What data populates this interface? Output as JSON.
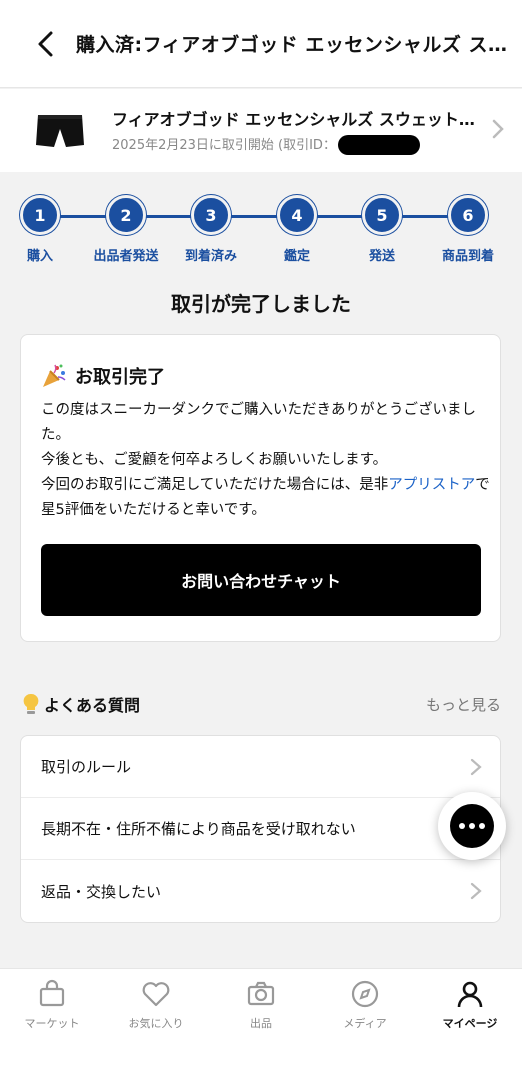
{
  "header": {
    "title": "購入済:フィアオブゴッド エッセンシャルズ スウェットショーツ"
  },
  "product": {
    "name": "フィアオブゴッド エッセンシャルズ スウェットショーツ",
    "meta": "2025年2月23日に取引開始 (取引ID："
  },
  "steps": [
    {
      "num": "1",
      "label": "購入"
    },
    {
      "num": "2",
      "label": "出品者発送"
    },
    {
      "num": "3",
      "label": "到着済み"
    },
    {
      "num": "4",
      "label": "鑑定"
    },
    {
      "num": "5",
      "label": "発送"
    },
    {
      "num": "6",
      "label": "商品到着"
    }
  ],
  "status_title": "取引が完了しました",
  "card": {
    "title": "お取引完了",
    "line1": "この度はスニーカーダンクでご購入いただきありがとうございました。",
    "line2": "今後とも、ご愛顧を何卒よろしくお願いいたします。",
    "line3_pre": "今回のお取引にご満足していただけた場合には、是非",
    "line3_link": "アプリストア",
    "line3_post": "で星5評価をいただけると幸いです。",
    "chat_button": "お問い合わせチャット"
  },
  "faq": {
    "title": "よくある質問",
    "more": "もっと見る",
    "items": [
      "取引のルール",
      "長期不在・住所不備により商品を受け取れない",
      "返品・交換したい"
    ]
  },
  "tabs": [
    {
      "label": "マーケット",
      "icon": "bag-icon"
    },
    {
      "label": "お気に入り",
      "icon": "heart-icon"
    },
    {
      "label": "出品",
      "icon": "camera-icon"
    },
    {
      "label": "メディア",
      "icon": "compass-icon"
    },
    {
      "label": "マイページ",
      "icon": "person-icon",
      "active": true
    }
  ],
  "colors": {
    "accent": "#1b4fa0",
    "link": "#1b62c7",
    "button": "#000000"
  }
}
